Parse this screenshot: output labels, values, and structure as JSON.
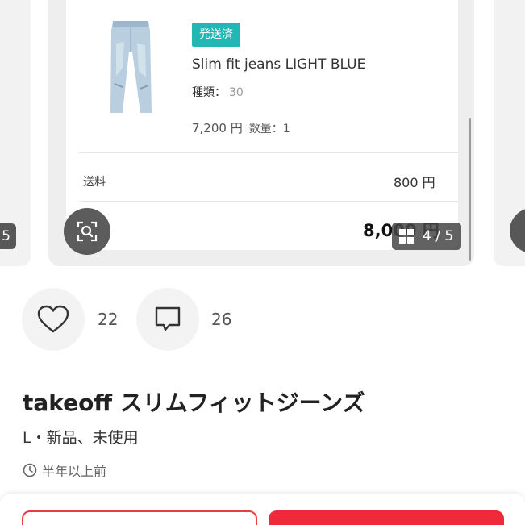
{
  "carousel": {
    "badge": "発送済",
    "product_name": "Slim fit jeans LIGHT BLUE",
    "kind_label": "種類：",
    "kind_value": "30",
    "price": "7,200 円",
    "quantity": "数量：1",
    "shipping_label": "送料",
    "shipping_value": "800 円",
    "total_value": "8,000 円",
    "counter": "4 / 5",
    "prev_counter": "5"
  },
  "actions": {
    "likes": "22",
    "comments": "26"
  },
  "item": {
    "title": "takeoff スリムフィットジーンズ",
    "subtitle": "L・新品、未使用",
    "posted": "半年以上前"
  },
  "colors": {
    "badge": "#22b6b4",
    "accent": "#ee2a3a"
  }
}
